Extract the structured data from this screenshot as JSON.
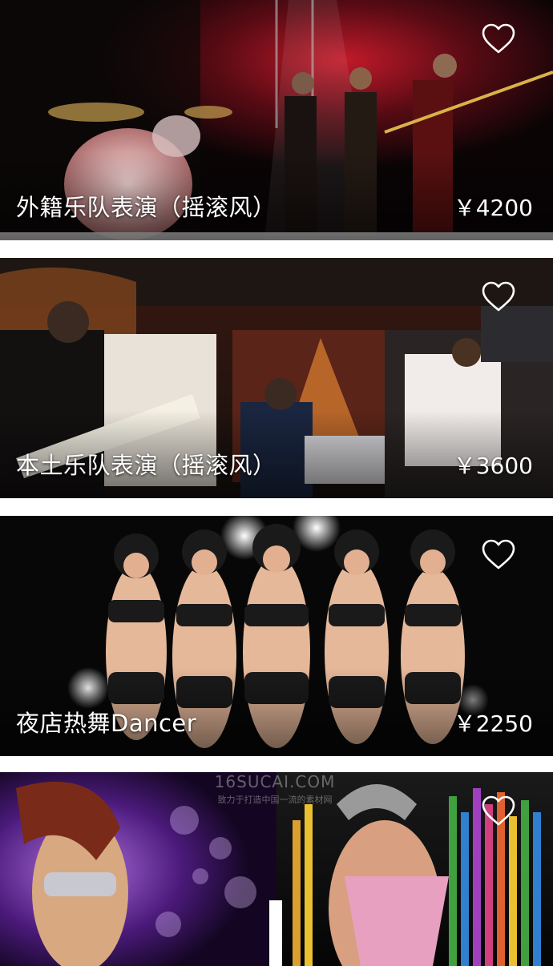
{
  "cards": [
    {
      "title": "外籍乐队表演（摇滚风）",
      "price": "￥4200",
      "favorite_icon": "heart-outline-icon"
    },
    {
      "title": "本土乐队表演（摇滚风）",
      "price": "￥3600",
      "favorite_icon": "heart-outline-icon"
    },
    {
      "title": "夜店热舞Dancer",
      "price": "￥2250",
      "favorite_icon": "heart-outline-icon"
    },
    {
      "title": "",
      "price": "",
      "favorite_icon": "heart-outline-icon"
    }
  ],
  "watermark": {
    "line1": "16SUCAI.COM",
    "line2": "致力于打造中国一流的素材网"
  }
}
